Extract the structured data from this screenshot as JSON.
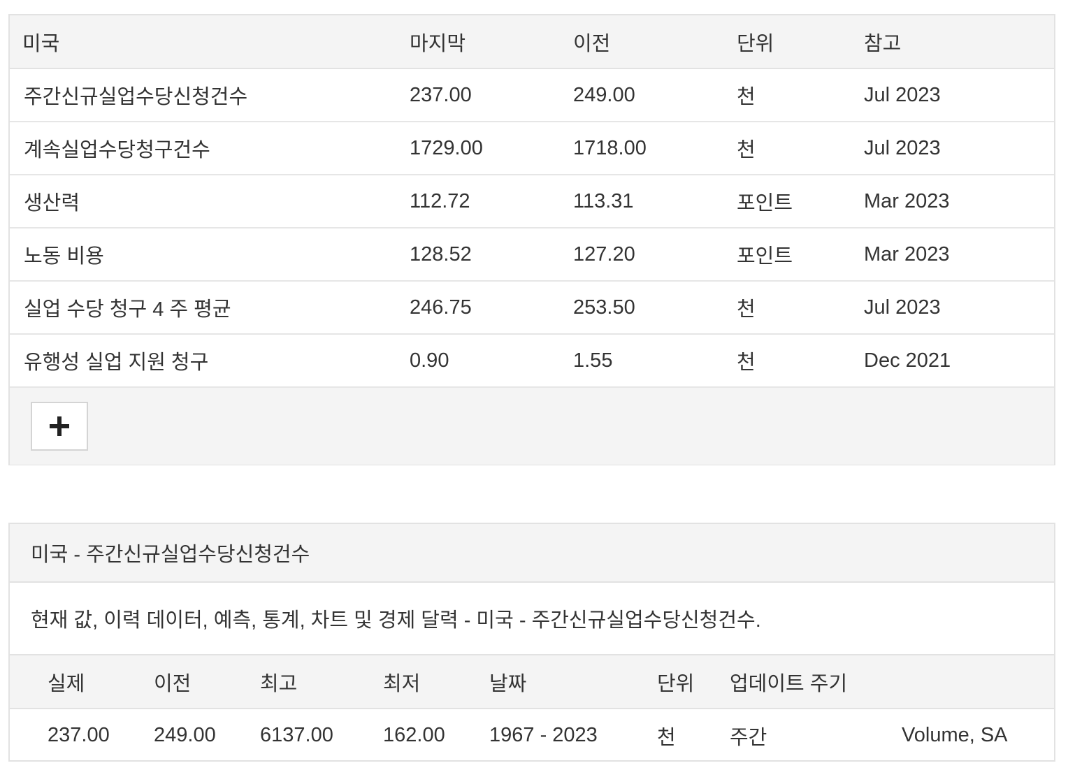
{
  "indicators_table": {
    "headers": [
      "미국",
      "마지막",
      "이전",
      "단위",
      "참고"
    ],
    "rows": [
      [
        "주간신규실업수당신청건수",
        "237.00",
        "249.00",
        "천",
        "Jul 2023"
      ],
      [
        "계속실업수당청구건수",
        "1729.00",
        "1718.00",
        "천",
        "Jul 2023"
      ],
      [
        "생산력",
        "112.72",
        "113.31",
        "포인트",
        "Mar 2023"
      ],
      [
        "노동 비용",
        "128.52",
        "127.20",
        "포인트",
        "Mar 2023"
      ],
      [
        "실업 수당 청구 4 주 평균",
        "246.75",
        "253.50",
        "천",
        "Jul 2023"
      ],
      [
        "유행성 실업 지원 청구",
        "0.90",
        "1.55",
        "천",
        "Dec 2021"
      ]
    ],
    "expand_button_label": "+"
  },
  "detail_panel": {
    "heading": "미국 - 주간신규실업수당신청건수",
    "description": "현재 값, 이력 데이터, 예측, 통계, 차트 및 경제 달력 - 미국 - 주간신규실업수당신청건수.",
    "summary_headers": [
      "실제",
      "이전",
      "최고",
      "최저",
      "날짜",
      "단위",
      "업데이트 주기",
      ""
    ],
    "summary_values": [
      "237.00",
      "249.00",
      "6137.00",
      "162.00",
      "1967 - 2023",
      "천",
      "주간",
      "Volume, SA"
    ]
  }
}
